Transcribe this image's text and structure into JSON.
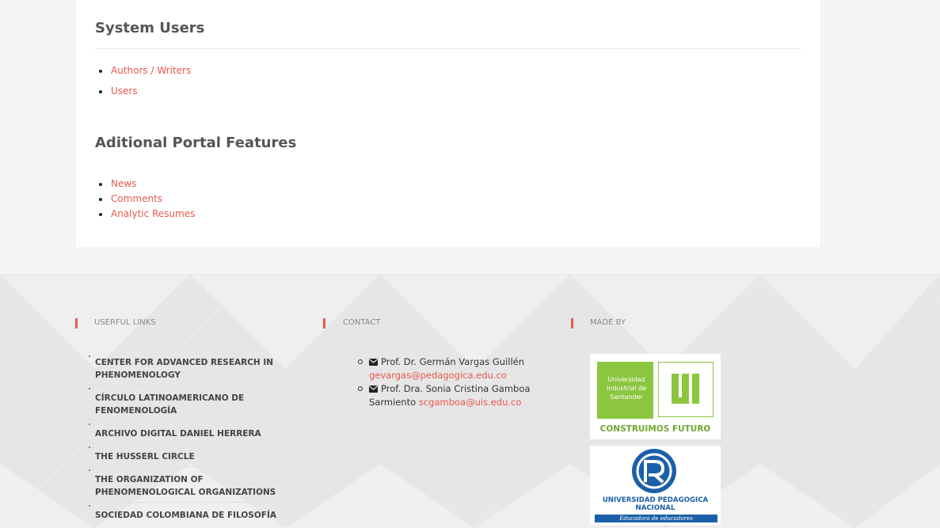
{
  "sections": {
    "system_users": {
      "title": "System Users",
      "items": [
        "Authors / Writers",
        "Users"
      ]
    },
    "additional_features": {
      "title": "Aditional Portal Features",
      "items": [
        "News",
        "Comments",
        "Analytic Resumes"
      ]
    }
  },
  "footer": {
    "useful_links": {
      "heading": "USERFUL LINKS",
      "items": [
        "CENTER FOR ADVANCED RESEARCH IN PHENOMENOLOGY",
        "CÍRCULO LATINOAMERICANO DE FENOMENOLOGÍA",
        "ARCHIVO DIGITAL DANIEL HERRERA",
        "THE HUSSERL CIRCLE",
        "THE ORGANIZATION OF PHENOMENOLOGICAL ORGANIZATIONS",
        "SOCIEDAD COLOMBIANA DE FILOSOFÍA"
      ]
    },
    "contact": {
      "heading": "CONTACT",
      "people": [
        {
          "name": "Prof. Dr. Germán Vargas Guillén",
          "email": "gevargas@pedagogica.edu.co"
        },
        {
          "name": "Prof. Dra. Sonia Cristina Gamboa Sarmiento",
          "email": "scgamboa@uis.edu.co"
        }
      ]
    },
    "made_by": {
      "heading": "MADE BY",
      "uis": {
        "line1": "Universidad",
        "line2": "Industrial de",
        "line3": "Santander",
        "slogan": "CONSTRUIMOS FUTURO"
      },
      "upn": {
        "line1": "UNIVERSIDAD PEDAGOGICA",
        "line2": "NACIONAL",
        "tagline": "Educadora de educadores"
      }
    }
  },
  "colors": {
    "accent": "#e8584d",
    "uis_green": "#8cc63f",
    "upn_blue": "#1b5fa8"
  }
}
